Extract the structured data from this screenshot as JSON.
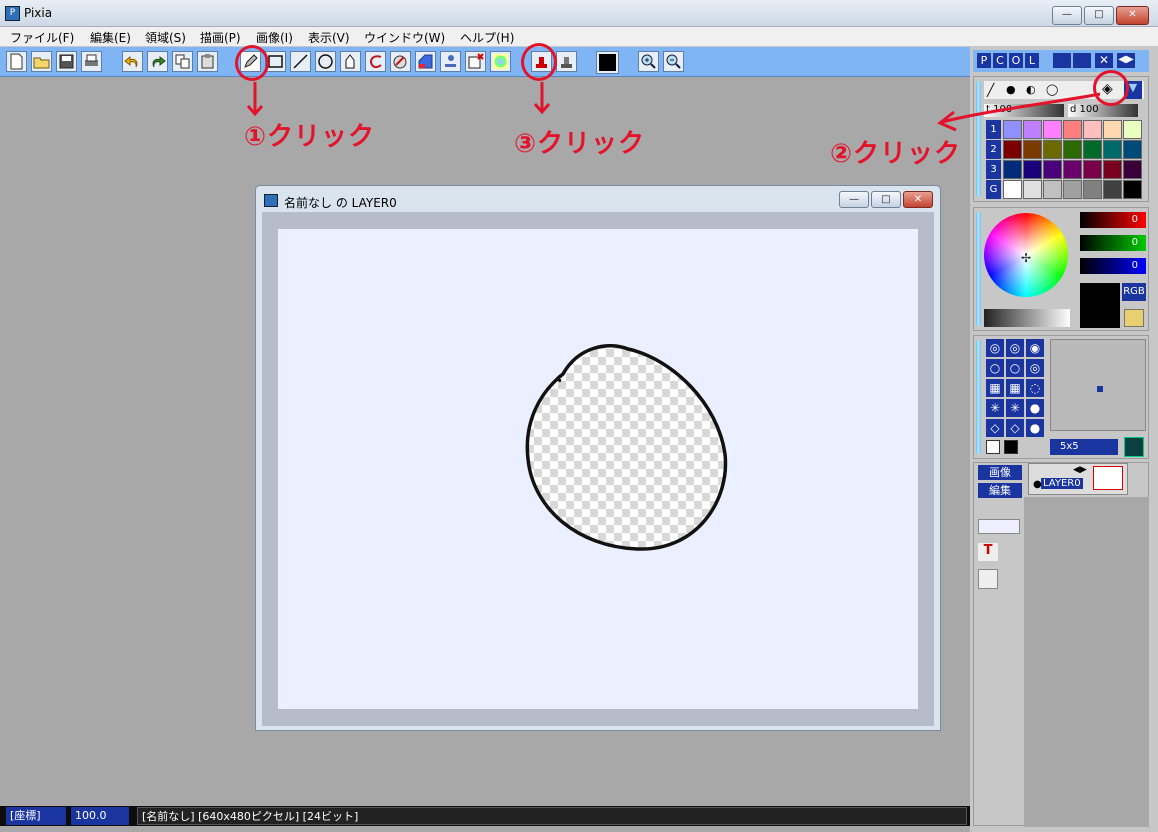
{
  "window": {
    "title": "Pixia",
    "minimize": "—",
    "maximize": "□",
    "close": "✕"
  },
  "menu": [
    "ファイル(F)",
    "編集(E)",
    "領域(S)",
    "描画(P)",
    "画像(I)",
    "表示(V)",
    "ウインドウ(W)",
    "ヘルプ(H)"
  ],
  "toolbar": {
    "left_tools": [
      "new-file-icon",
      "open-folder-icon",
      "save-icon",
      "print-icon",
      "undo-icon",
      "redo-icon",
      "copy-icon",
      "paste-icon"
    ],
    "draw_tools": [
      "pen-icon",
      "rectangle-icon",
      "line-icon",
      "ellipse-icon",
      "fill-shape-icon",
      "curve-icon",
      "brush-icon",
      "gradient-icon",
      "stamp-icon",
      "clear-icon",
      "transparent-icon"
    ],
    "right_tools": [
      "eraser-stamp-icon",
      "stamp2-icon",
      "color-swatch",
      "zoom-in-icon",
      "zoom-out-icon"
    ],
    "current_color": "#000000"
  },
  "document": {
    "title": "名前なし の LAYER0"
  },
  "annotations": {
    "step1": "①クリック",
    "step2": "②クリック",
    "step3": "③クリック",
    "color": "#e3132b"
  },
  "panel_tabs": [
    "P",
    "C",
    "O",
    "L"
  ],
  "color_panel": {
    "opacity_label": "t",
    "opacity_value": "100",
    "density_label": "d",
    "density_value": "100",
    "rows": [
      "1",
      "2",
      "3",
      "G"
    ],
    "palette": [
      [
        "#8f8fff",
        "#c07fff",
        "#ff7fff",
        "#ff7f7f",
        "#ffbfbf",
        "#ffd8b0",
        "#e8ffc0"
      ],
      [
        "#7a0000",
        "#7a3a00",
        "#6a6a00",
        "#2a6a00",
        "#006a2a",
        "#006a6a",
        "#004a7a"
      ],
      [
        "#002a7a",
        "#1a007a",
        "#4a007a",
        "#6a006a",
        "#7a004a",
        "#7a0020",
        "#3a003a"
      ],
      [
        "#ffffff",
        "#e0e0e0",
        "#c0c0c0",
        "#a0a0a0",
        "#808080",
        "#404040",
        "#000000"
      ]
    ]
  },
  "rgb_panel": {
    "r": "0",
    "g": "0",
    "b": "0",
    "mode": "RGB"
  },
  "brush_panel": {
    "size": "5x5"
  },
  "layer_panel": {
    "image_btn": "画像",
    "edit_btn": "編集",
    "layer_name": "LAYER0"
  },
  "status": {
    "coords": "[座標]",
    "zoom": "100.0",
    "info": "[名前なし] [640x480ピクセル] [24ビット]"
  }
}
